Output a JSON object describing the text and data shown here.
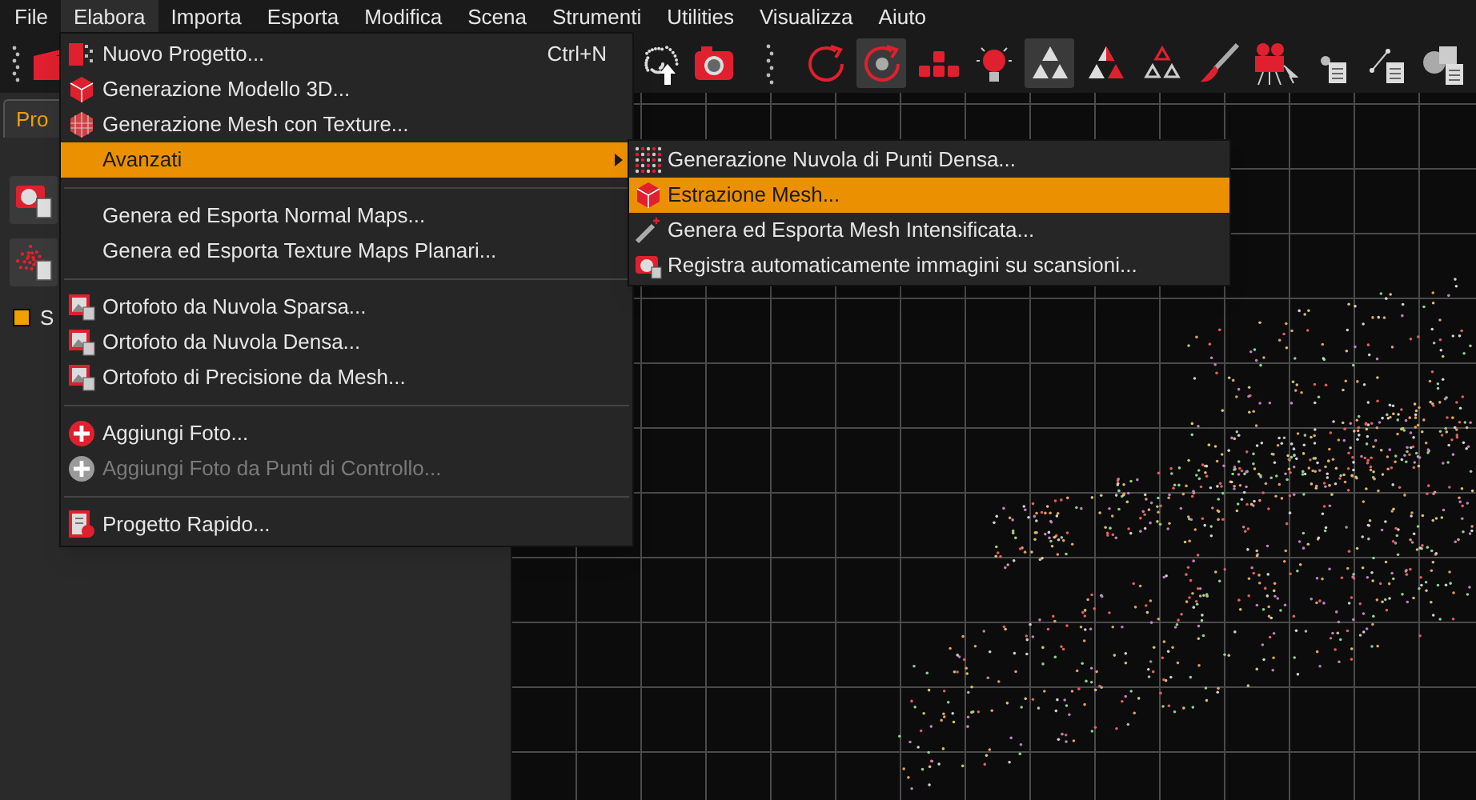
{
  "menubar": [
    {
      "label": "File",
      "selected": false
    },
    {
      "label": "Elabora",
      "selected": true
    },
    {
      "label": "Importa",
      "selected": false
    },
    {
      "label": "Esporta",
      "selected": false
    },
    {
      "label": "Modifica",
      "selected": false
    },
    {
      "label": "Scena",
      "selected": false
    },
    {
      "label": "Strumenti",
      "selected": false
    },
    {
      "label": "Utilities",
      "selected": false
    },
    {
      "label": "Visualizza",
      "selected": false
    },
    {
      "label": "Aiuto",
      "selected": false
    }
  ],
  "toolbar": [
    {
      "kind": "dots",
      "selected": false
    },
    {
      "kind": "camera",
      "selected": false
    },
    {
      "kind": "grip",
      "selected": false
    },
    {
      "kind": "rotate",
      "selected": false
    },
    {
      "kind": "target",
      "selected": true
    },
    {
      "kind": "keys",
      "selected": false
    },
    {
      "kind": "bulb",
      "selected": false
    },
    {
      "kind": "tri-grey",
      "selected": true
    },
    {
      "kind": "tri-red",
      "selected": false
    },
    {
      "kind": "tri-outline",
      "selected": false
    },
    {
      "kind": "brush",
      "selected": false
    },
    {
      "kind": "video",
      "selected": false
    },
    {
      "kind": "doc",
      "selected": false
    },
    {
      "kind": "doc-line",
      "selected": false
    },
    {
      "kind": "doc-shapes",
      "selected": false
    }
  ],
  "left_panel": {
    "tab": "Pro",
    "layer": {
      "label": "S",
      "checked": true
    }
  },
  "menu": {
    "items": [
      {
        "kind": "item",
        "label": "Nuovo Progetto...",
        "shortcut": "Ctrl+N",
        "selected": false,
        "disabled": false
      },
      {
        "kind": "item",
        "label": "Generazione Modello 3D...",
        "selected": false,
        "disabled": false
      },
      {
        "kind": "item",
        "label": "Generazione Mesh con Texture...",
        "selected": false,
        "disabled": false
      },
      {
        "kind": "submenu",
        "label": "Avanzati",
        "selected": true,
        "disabled": false
      },
      {
        "kind": "separator"
      },
      {
        "kind": "item",
        "label": "Genera ed Esporta Normal Maps...",
        "selected": false,
        "disabled": false
      },
      {
        "kind": "item",
        "label": "Genera ed Esporta Texture Maps Planari...",
        "selected": false,
        "disabled": false
      },
      {
        "kind": "separator"
      },
      {
        "kind": "item",
        "label": "Ortofoto da Nuvola Sparsa...",
        "selected": false,
        "disabled": false
      },
      {
        "kind": "item",
        "label": "Ortofoto da Nuvola Densa...",
        "selected": false,
        "disabled": false
      },
      {
        "kind": "item",
        "label": "Ortofoto di Precisione da Mesh...",
        "selected": false,
        "disabled": false
      },
      {
        "kind": "separator"
      },
      {
        "kind": "item",
        "label": "Aggiungi Foto...",
        "selected": false,
        "disabled": false
      },
      {
        "kind": "item",
        "label": "Aggiungi Foto da Punti di Controllo...",
        "selected": false,
        "disabled": true
      },
      {
        "kind": "separator"
      },
      {
        "kind": "item",
        "label": "Progetto Rapido...",
        "selected": false,
        "disabled": false
      }
    ]
  },
  "submenu": {
    "items": [
      {
        "label": "Generazione Nuvola di Punti Densa...",
        "selected": false
      },
      {
        "label": "Estrazione Mesh...",
        "selected": true
      },
      {
        "label": "Genera ed Esporta Mesh Intensificata...",
        "selected": false
      },
      {
        "label": "Registra automaticamente immagini su scansioni...",
        "selected": false
      }
    ]
  }
}
